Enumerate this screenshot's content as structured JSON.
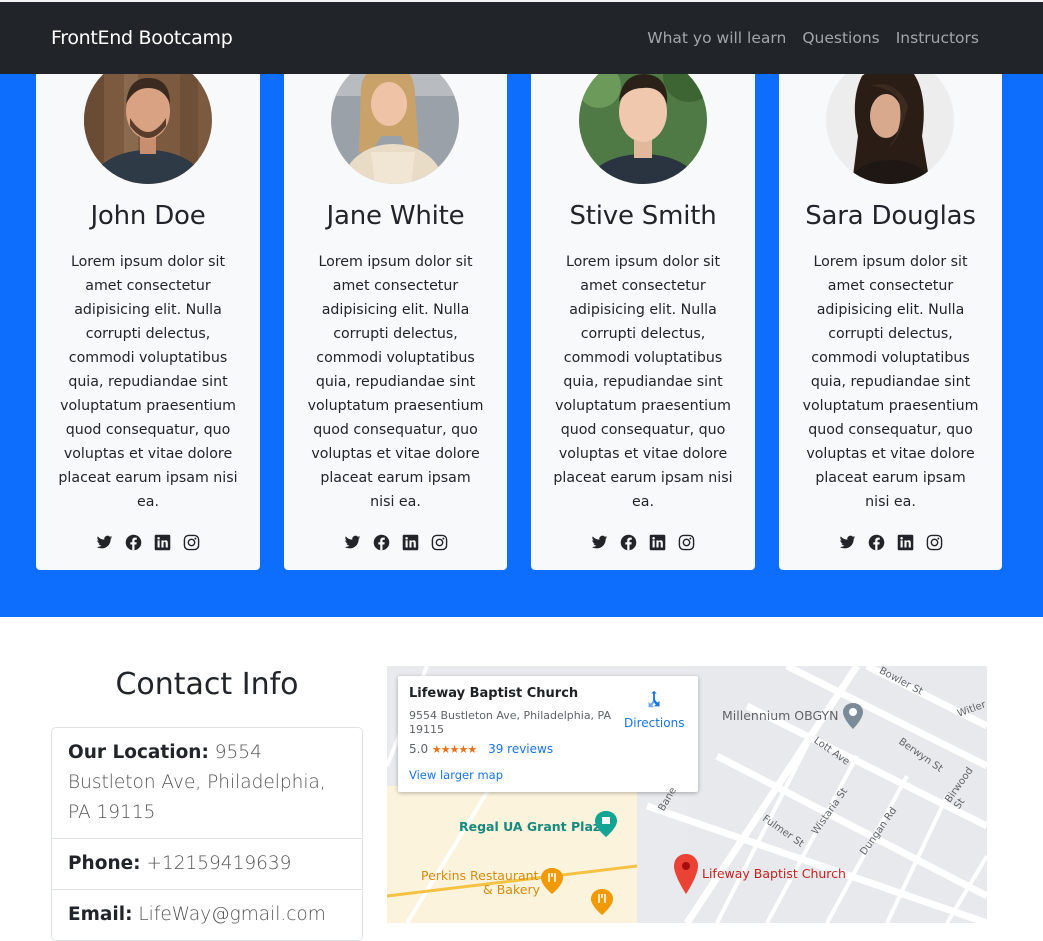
{
  "navbar": {
    "brand": "FrontEnd Bootcamp",
    "links": [
      "What yo will learn",
      "Questions",
      "Instructors"
    ]
  },
  "instructors": [
    {
      "name": "John Doe",
      "bio": "Lorem ipsum dolor sit amet consectetur adipisicing elit. Nulla corrupti delectus, commodi voluptatibus quia, repudiandae sint voluptatum praesentium quod consequatur, quo voluptas et vitae dolore placeat earum ipsam nisi ea."
    },
    {
      "name": "Jane White",
      "bio": "Lorem ipsum dolor sit amet consectetur adipisicing elit. Nulla corrupti delectus, commodi voluptatibus quia, repudiandae sint voluptatum praesentium quod consequatur, quo voluptas et vitae dolore placeat earum ipsam nisi ea."
    },
    {
      "name": "Stive Smith",
      "bio": "Lorem ipsum dolor sit amet consectetur adipisicing elit. Nulla corrupti delectus, commodi voluptatibus quia, repudiandae sint voluptatum praesentium quod consequatur, quo voluptas et vitae dolore placeat earum ipsam nisi ea."
    },
    {
      "name": "Sara Douglas",
      "bio": "Lorem ipsum dolor sit amet consectetur adipisicing elit. Nulla corrupti delectus, commodi voluptatibus quia, repudiandae sint voluptatum praesentium quod consequatur, quo voluptas et vitae dolore placeat earum ipsam nisi ea."
    }
  ],
  "social_icons": [
    "twitter-icon",
    "facebook-icon",
    "linkedin-icon",
    "instagram-icon"
  ],
  "contact": {
    "title": "Contact Info",
    "location_label": "Our Location:",
    "location_value": "9554 Bustleton Ave, Philadelphia, PA 19115",
    "phone_label": "Phone:",
    "phone_value": "+12159419639",
    "email_label": "Email:",
    "email_value": "LifeWay@gmail.com"
  },
  "map": {
    "place_name": "Lifeway Baptist Church",
    "address": "9554 Bustleton Ave, Philadelphia, PA 19115",
    "rating": "5.0",
    "stars": "★★★★★",
    "reviews": "39 reviews",
    "directions": "Directions",
    "larger_map": "View larger map",
    "pois": {
      "millennium": "Millennium OBGYN",
      "regal": "Regal UA Grant Plaza",
      "perkins_1": "Perkins Restaurant",
      "perkins_2": "& Bakery",
      "lifeway": "Lifeway Baptist Church"
    },
    "streets": {
      "bowler": "Bowler St",
      "witler": "Witler",
      "berwyn": "Berwyn St",
      "birwood": "Birwood St",
      "lott": "Lott Ave",
      "wistaria": "Wistaria St",
      "fulmer": "Fulmer St",
      "dungan": "Dungan Rd",
      "bane": "Bane"
    }
  },
  "colors": {
    "navbar": "#212529",
    "band": "#0d6efd",
    "card": "#f8f9fa",
    "map_link": "#1a73e8",
    "pin": "#ea4335"
  }
}
